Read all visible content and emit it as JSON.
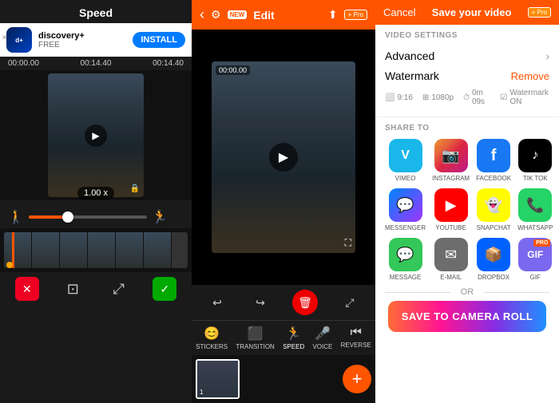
{
  "left": {
    "title": "Speed",
    "ad": {
      "name": "discovery+",
      "sub": "FREE",
      "install_label": "INSTALL"
    },
    "timeline": {
      "t1": "00:00.00",
      "t2": "00:14.40",
      "t3": "00:14.40"
    },
    "speed_badge": "1.00 x",
    "bottom_actions": {
      "close": "✕",
      "crop": "⊡",
      "resize": "⤢",
      "check": "✓"
    }
  },
  "mid": {
    "header": {
      "edit_label": "Edit",
      "new_label": "NEW"
    },
    "video": {
      "timestamp": "00:00.00"
    },
    "toolbar": [
      {
        "label": "STICKERS",
        "icon": "😊"
      },
      {
        "label": "TRANSITION",
        "icon": "⬛"
      },
      {
        "label": "SPEED",
        "icon": "🏃"
      },
      {
        "label": "VOICE",
        "icon": "🎤"
      },
      {
        "label": "REVERSE",
        "icon": "◀◀"
      }
    ],
    "add_label": "+"
  },
  "right": {
    "header": {
      "cancel_label": "Cancel",
      "save_label": "Save your video",
      "pro_label": "+ Pro"
    },
    "video_settings": {
      "section_label": "VIDEO SETTINGS",
      "advanced_label": "Advanced",
      "watermark_label": "Watermark",
      "remove_label": "Remove",
      "meta": {
        "ratio": "9:16",
        "resolution": "1080p",
        "duration": "0m 09s",
        "watermark": "Watermark ON"
      }
    },
    "share": {
      "section_label": "SHARE TO",
      "items": [
        {
          "label": "VIMEO",
          "class": "vimeo",
          "icon": "V"
        },
        {
          "label": "INSTAGRAM",
          "class": "instagram",
          "icon": "📷"
        },
        {
          "label": "FACEBOOK",
          "class": "facebook",
          "icon": "f"
        },
        {
          "label": "TIK TOK",
          "class": "tiktok",
          "icon": "♪"
        },
        {
          "label": "MESSENGER",
          "class": "messenger",
          "icon": "💬"
        },
        {
          "label": "YOUTUBE",
          "class": "youtube",
          "icon": "▶"
        },
        {
          "label": "SNAPCHAT",
          "class": "snapchat",
          "icon": "👻"
        },
        {
          "label": "WHATSAPP",
          "class": "whatsapp",
          "icon": "📞"
        },
        {
          "label": "MESSAGE",
          "class": "message",
          "icon": "💬"
        },
        {
          "label": "E-MAIL",
          "class": "email",
          "icon": "✉"
        },
        {
          "label": "DROPBOX",
          "class": "dropbox",
          "icon": "📦"
        },
        {
          "label": "GIF",
          "class": "gif",
          "icon": "GIF",
          "pro": "PRO"
        }
      ],
      "or_label": "OR",
      "save_to_camera_roll": "SAVE TO CAMERA ROLL"
    }
  }
}
